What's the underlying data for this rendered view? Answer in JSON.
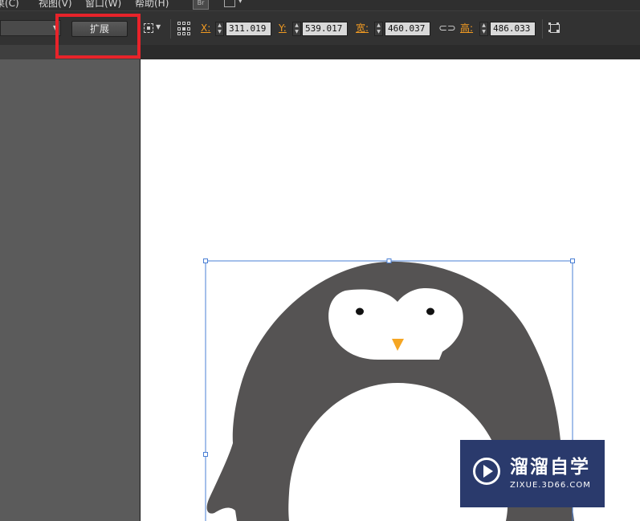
{
  "menu": {
    "items": [
      {
        "label": "果(C)",
        "id": "effect"
      },
      {
        "label": "视图(V)",
        "id": "view"
      },
      {
        "label": "窗口(W)",
        "id": "window"
      },
      {
        "label": "帮助(H)",
        "id": "help"
      }
    ],
    "bridge_label": "Br"
  },
  "control_bar": {
    "expand_button_label": "扩展",
    "x_label": "X:",
    "x_value": "311.019 :",
    "y_label": "Y:",
    "y_value": "539.017 :",
    "width_label": "宽:",
    "width_value": "460.037 :",
    "height_label": "高:",
    "height_value": "486.033 :"
  },
  "colors": {
    "highlight": "#e8232a",
    "label_orange": "#f29b22",
    "penguin_body": "#555353",
    "penguin_beak": "#f5a623",
    "selection": "#4a7fd4",
    "watermark_bg": "#2a3a6c"
  },
  "icons": [
    "reference-point-icon",
    "grid-align-icon",
    "link-icon",
    "transform-icon",
    "workspace-icon",
    "bridge-icon",
    "play-logo-icon"
  ],
  "watermark": {
    "title": "溜溜自学",
    "subtitle": "ZIXUE.3D66.COM"
  }
}
